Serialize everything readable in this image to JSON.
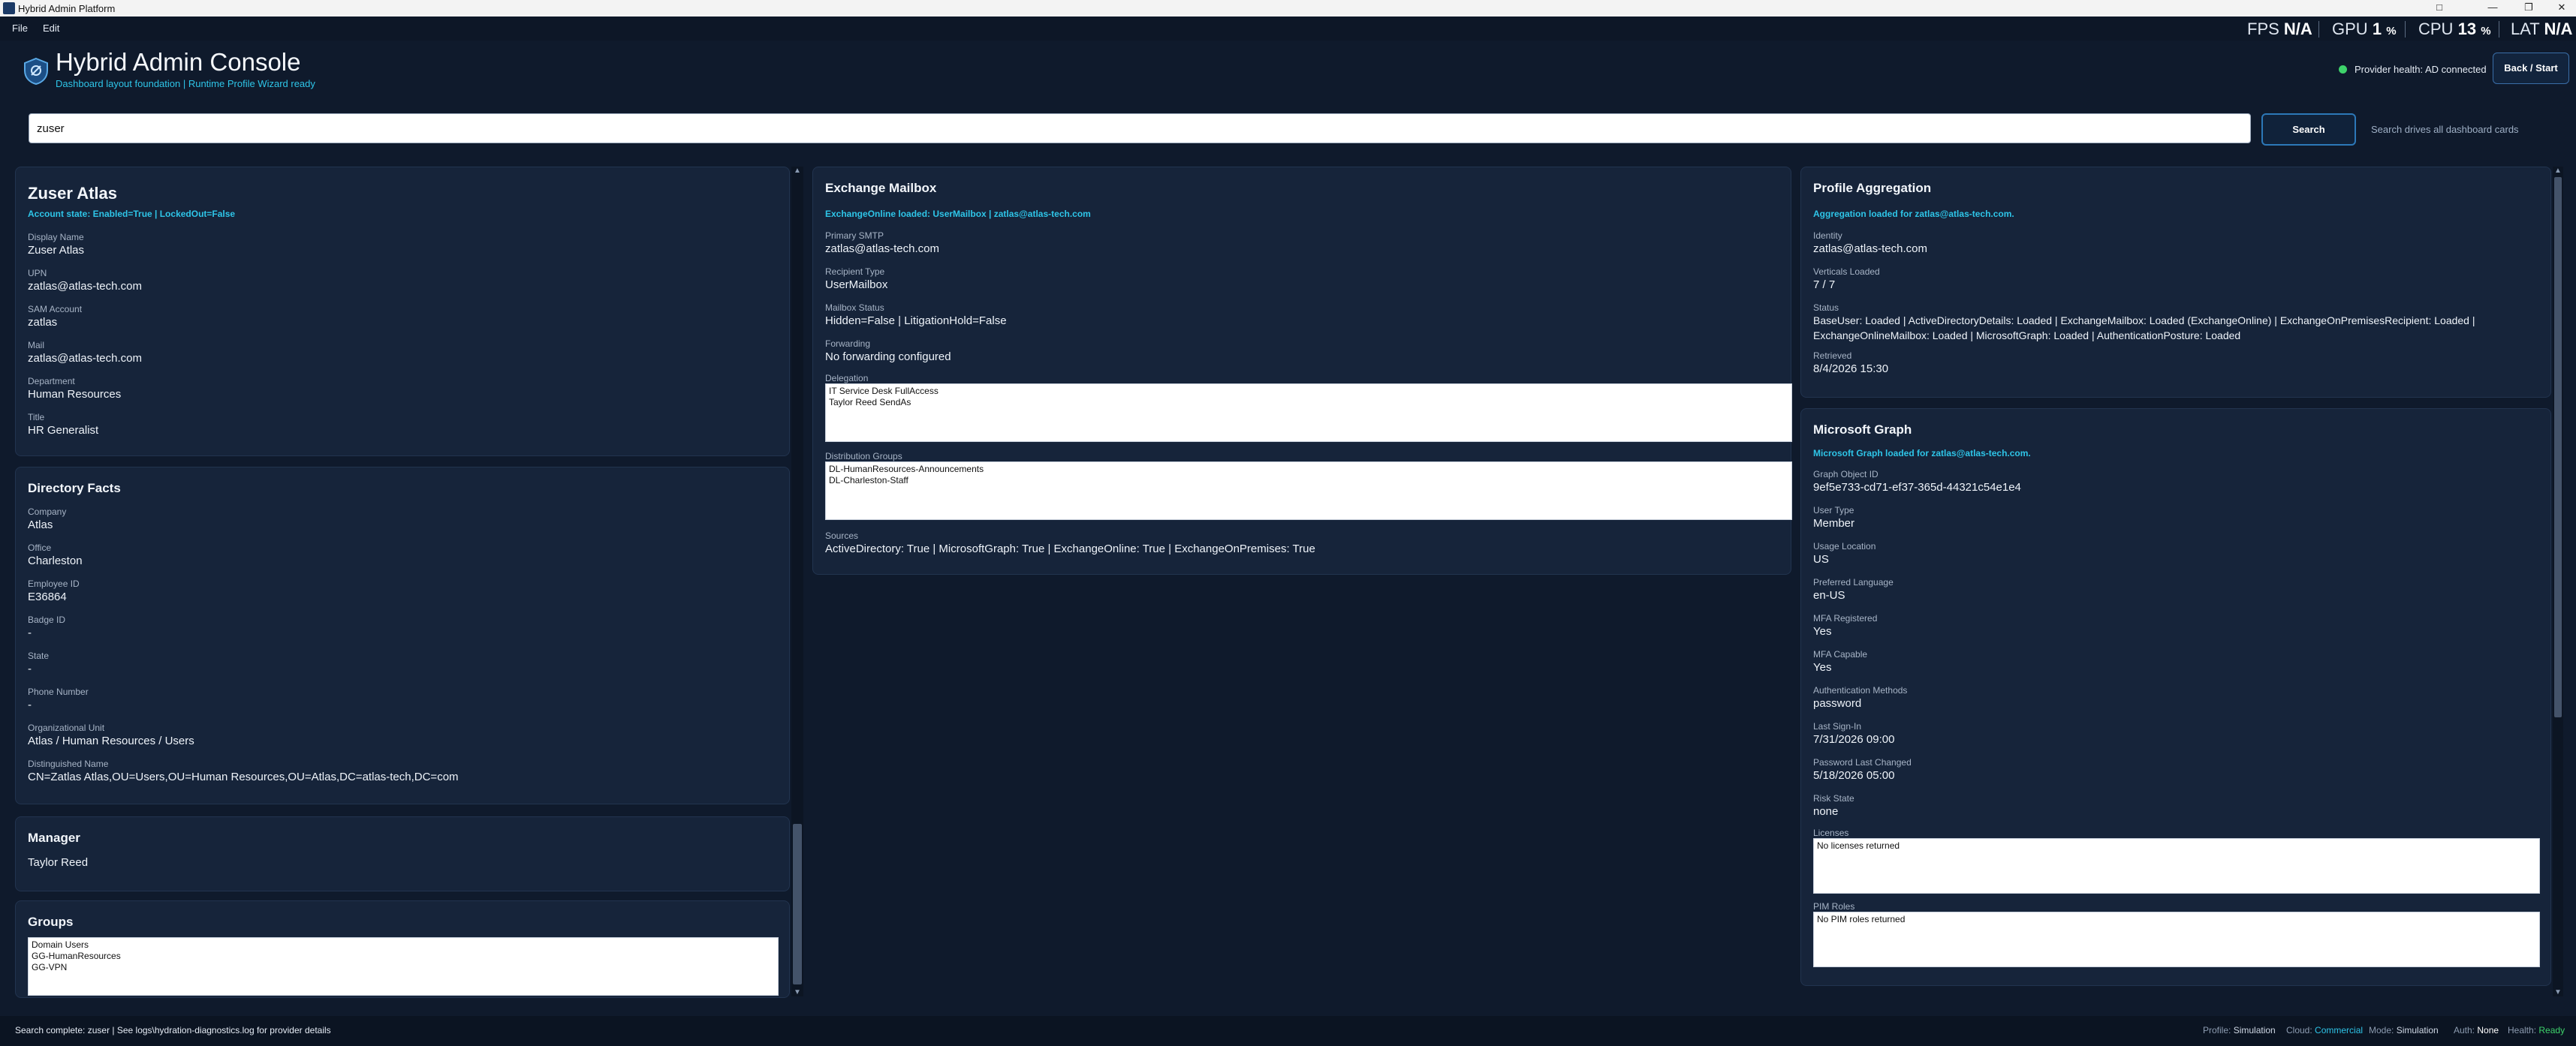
{
  "window": {
    "title": "Hybrid Admin Platform"
  },
  "menu": {
    "file": "File",
    "edit": "Edit"
  },
  "perf": {
    "fps_label": "FPS",
    "fps_value": "N/A",
    "gpu_label": "GPU",
    "gpu_value": "1",
    "gpu_unit": "%",
    "cpu_label": "CPU",
    "cpu_value": "13",
    "cpu_unit": "%",
    "lat_label": "LAT",
    "lat_value": "N/A"
  },
  "header": {
    "title": "Hybrid Admin Console",
    "subtitle": "Dashboard layout foundation | Runtime Profile Wizard ready",
    "health": "Provider health: AD connected",
    "back_button": "Back / Start"
  },
  "search": {
    "value": "zuser",
    "button": "Search",
    "hint": "Search drives all dashboard cards"
  },
  "identity": {
    "name": "Zuser Atlas",
    "status": "Account state: Enabled=True | LockedOut=False",
    "fields": [
      {
        "label": "Display Name",
        "value": "Zuser Atlas"
      },
      {
        "label": "UPN",
        "value": "zatlas@atlas-tech.com"
      },
      {
        "label": "SAM Account",
        "value": "zatlas"
      },
      {
        "label": "Mail",
        "value": "zatlas@atlas-tech.com"
      },
      {
        "label": "Department",
        "value": "Human Resources"
      },
      {
        "label": "Title",
        "value": "HR Generalist"
      }
    ]
  },
  "directory": {
    "title": "Directory Facts",
    "fields": [
      {
        "label": "Company",
        "value": "Atlas"
      },
      {
        "label": "Office",
        "value": "Charleston"
      },
      {
        "label": "Employee ID",
        "value": "E36864"
      },
      {
        "label": "Badge ID",
        "value": "-"
      },
      {
        "label": "State",
        "value": "-"
      },
      {
        "label": "Phone Number",
        "value": "-"
      },
      {
        "label": "Organizational Unit",
        "value": "Atlas / Human Resources / Users"
      },
      {
        "label": "Distinguished Name",
        "value": "CN=Zatlas Atlas,OU=Users,OU=Human Resources,OU=Atlas,DC=atlas-tech,DC=com"
      }
    ]
  },
  "manager": {
    "title": "Manager",
    "value": "Taylor Reed"
  },
  "groups": {
    "title": "Groups",
    "items": [
      "Domain Users",
      "GG-HumanResources",
      "GG-VPN"
    ]
  },
  "exchange": {
    "title": "Exchange Mailbox",
    "status": "ExchangeOnline loaded: UserMailbox | zatlas@atlas-tech.com",
    "fields": [
      {
        "label": "Primary SMTP",
        "value": "zatlas@atlas-tech.com"
      },
      {
        "label": "Recipient Type",
        "value": "UserMailbox"
      },
      {
        "label": "Mailbox Status",
        "value": "Hidden=False | LitigationHold=False"
      },
      {
        "label": "Forwarding",
        "value": "No forwarding configured"
      }
    ],
    "delegation_label": "Delegation",
    "delegation": [
      "IT Service Desk FullAccess",
      "Taylor Reed SendAs"
    ],
    "dist_label": "Distribution Groups",
    "dist_groups": [
      "DL-HumanResources-Announcements",
      "DL-Charleston-Staff"
    ],
    "sources_label": "Sources",
    "sources": "ActiveDirectory: True | MicrosoftGraph: True | ExchangeOnline: True | ExchangeOnPremises: True"
  },
  "aggregation": {
    "title": "Profile Aggregation",
    "status": "Aggregation loaded for zatlas@atlas-tech.com.",
    "identity_label": "Identity",
    "identity": "zatlas@atlas-tech.com",
    "verticals_label": "Verticals Loaded",
    "verticals": "7 / 7",
    "status_label": "Status",
    "status_line1": "BaseUser: Loaded | ActiveDirectoryDetails: Loaded | ExchangeMailbox: Loaded (ExchangeOnline) | ExchangeOnPremisesRecipient: Loaded |",
    "status_line2": "ExchangeOnlineMailbox: Loaded | MicrosoftGraph: Loaded | AuthenticationPosture: Loaded",
    "retrieved_label": "Retrieved",
    "retrieved": "8/4/2026 15:30"
  },
  "graph": {
    "title": "Microsoft Graph",
    "status": "Microsoft Graph loaded for zatlas@atlas-tech.com.",
    "fields": [
      {
        "label": "Graph Object ID",
        "value": "9ef5e733-cd71-ef37-365d-44321c54e1e4"
      },
      {
        "label": "User Type",
        "value": "Member"
      },
      {
        "label": "Usage Location",
        "value": "US"
      },
      {
        "label": "Preferred Language",
        "value": "en-US"
      },
      {
        "label": "MFA Registered",
        "value": "Yes"
      },
      {
        "label": "MFA Capable",
        "value": "Yes"
      },
      {
        "label": "Authentication Methods",
        "value": "password"
      },
      {
        "label": "Last Sign-In",
        "value": "7/31/2026 09:00"
      },
      {
        "label": "Password Last Changed",
        "value": "5/18/2026 05:00"
      },
      {
        "label": "Risk State",
        "value": "none"
      }
    ],
    "licenses_label": "Licenses",
    "licenses": "No licenses returned",
    "pim_label": "PIM Roles",
    "pim": "No PIM roles returned"
  },
  "statusbar": {
    "message": "Search complete: zuser | See logs\\hydration-diagnostics.log for provider details",
    "profile_label": "Profile:",
    "profile": "Simulation",
    "cloud_label": "Cloud:",
    "cloud": "Commercial",
    "mode_label": "Mode:",
    "mode": "Simulation",
    "auth_label": "Auth:",
    "auth": "None",
    "health_label": "Health:",
    "health": "Ready"
  },
  "colors": {
    "background": "#0f1a2c",
    "card": "#16243a",
    "accent": "#2ec5e8",
    "ok": "#3ed36b"
  },
  "icons": [
    "app-shield-icon",
    "minimize-icon",
    "maximize-icon",
    "close-icon",
    "status-dot-icon"
  ]
}
